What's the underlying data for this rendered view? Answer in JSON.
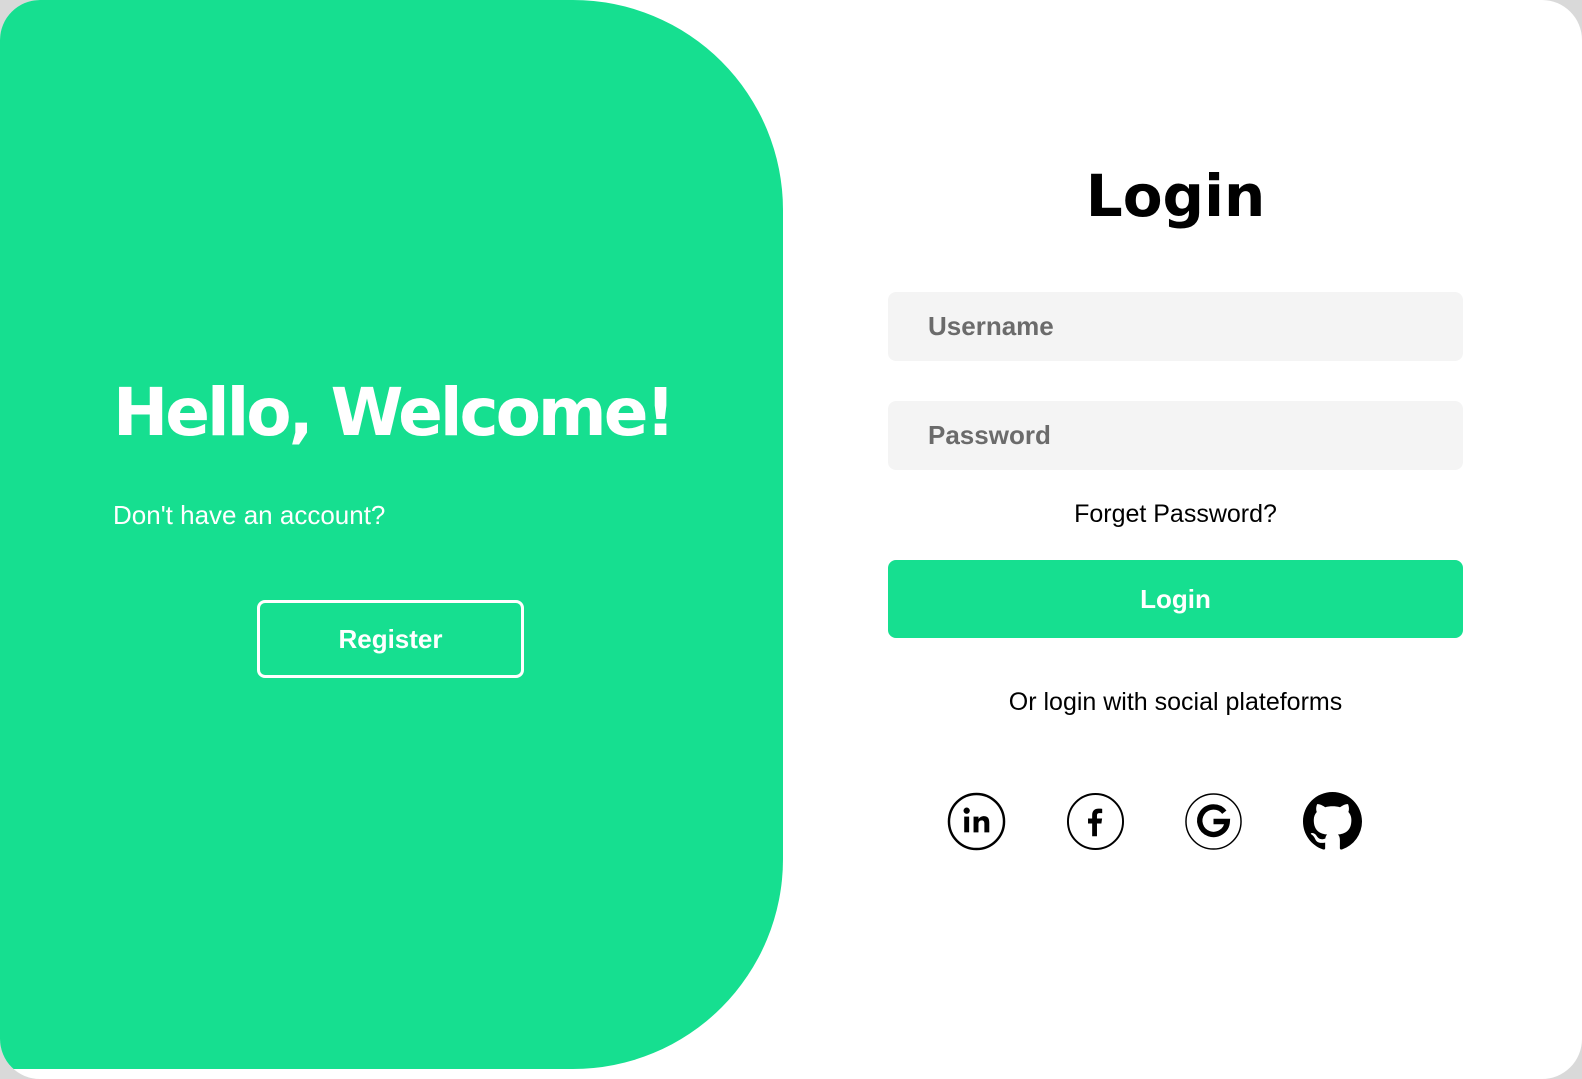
{
  "welcome": {
    "title": "Hello, Welcome!",
    "subtitle": "Don't have an account?",
    "register_label": "Register"
  },
  "login": {
    "title": "Login",
    "username_placeholder": "Username",
    "password_placeholder": "Password",
    "forget_label": "Forget Password?",
    "button_label": "Login",
    "social_text": "Or login with social plateforms"
  },
  "social": {
    "icons": [
      "linkedin-icon",
      "facebook-icon",
      "google-icon",
      "github-icon"
    ]
  },
  "colors": {
    "accent": "#16df90",
    "field_bg": "#f4f4f4",
    "text": "#000000"
  }
}
